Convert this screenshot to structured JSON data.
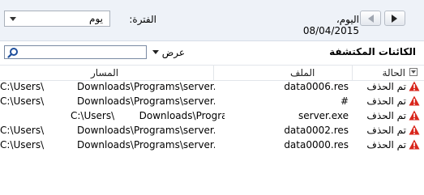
{
  "toolbar": {
    "date_label": "اليوم، 08/04/2015",
    "period_label": "الفترة:",
    "period_value": "يوم"
  },
  "section": {
    "title": "الكائنات المكتشفة",
    "view_label": "عرض",
    "search_placeholder": ""
  },
  "columns": {
    "status": "الحالة",
    "file": "الملف",
    "path": "المسار"
  },
  "rows": [
    {
      "status": "تم الحذف",
      "file": "data0006.res",
      "path_a": "Downloads\\Programs\\server.exe",
      "path_b": "C:\\Users\\"
    },
    {
      "status": "تم الحذف",
      "file": "#",
      "path_a": "Downloads\\Programs\\server.exe",
      "path_b": "C:\\Users\\"
    },
    {
      "status": "تم الحذف",
      "file": "server.exe",
      "path_a": "C:\\Users\\        Downloads\\Programs\\",
      "path_b": ""
    },
    {
      "status": "تم الحذف",
      "file": "data0002.res",
      "path_a": "Downloads\\Programs\\server.exe",
      "path_b": "C:\\Users\\"
    },
    {
      "status": "تم الحذف",
      "file": "data0000.res",
      "path_a": "Downloads\\Programs\\server.exe",
      "path_b": "C:\\Users\\"
    }
  ],
  "colors": {
    "toolbar_bg": "#eef2f8",
    "warning": "#d9261c"
  }
}
